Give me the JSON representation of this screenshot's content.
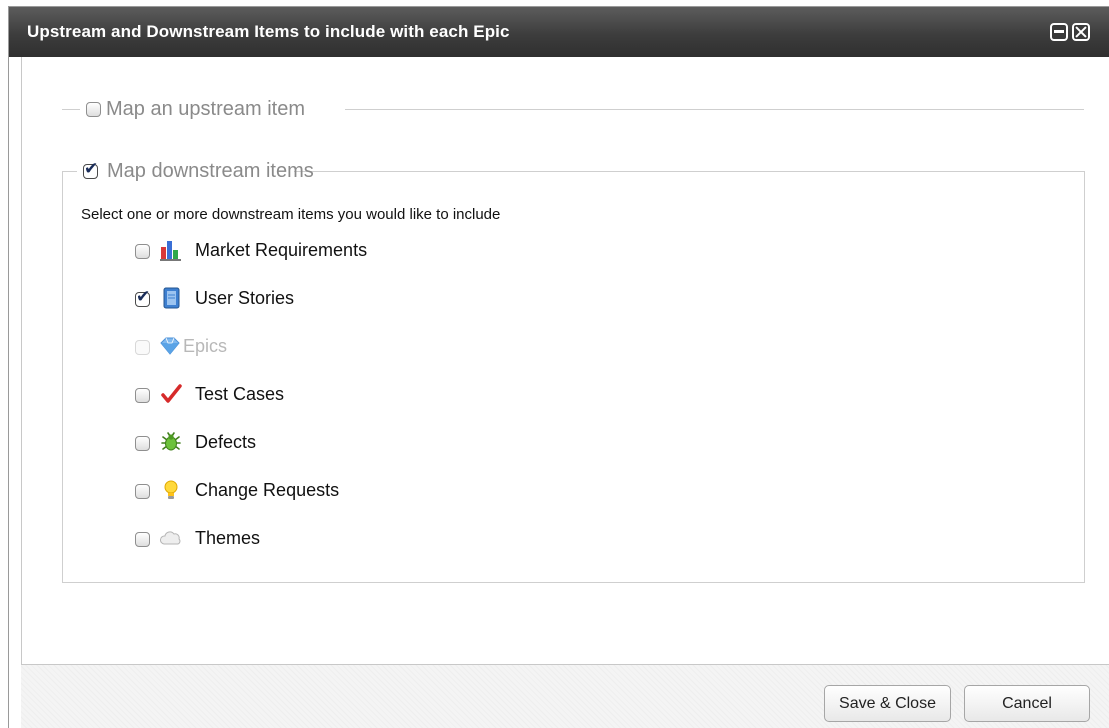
{
  "dialog": {
    "title": "Upstream and Downstream Items to include with each Epic",
    "minimize_icon": "minimize-icon",
    "close_icon": "close-icon"
  },
  "upstream": {
    "label": "Map an upstream item",
    "checked": false
  },
  "downstream": {
    "label": "Map downstream items",
    "checked": true,
    "instructions": "Select one or more downstream items you would like to include",
    "items": [
      {
        "label": "Market Requirements",
        "icon": "bar-chart-icon",
        "checked": false,
        "disabled": false
      },
      {
        "label": "User Stories",
        "icon": "book-icon",
        "checked": true,
        "disabled": false
      },
      {
        "label": "Epics",
        "icon": "diamond-icon",
        "checked": false,
        "disabled": true
      },
      {
        "label": "Test Cases",
        "icon": "checkmark-icon",
        "checked": false,
        "disabled": false
      },
      {
        "label": "Defects",
        "icon": "bug-icon",
        "checked": false,
        "disabled": false
      },
      {
        "label": "Change Requests",
        "icon": "lightbulb-icon",
        "checked": false,
        "disabled": false
      },
      {
        "label": "Themes",
        "icon": "cloud-icon",
        "checked": false,
        "disabled": false
      }
    ]
  },
  "footer": {
    "save_label": "Save & Close",
    "cancel_label": "Cancel"
  }
}
